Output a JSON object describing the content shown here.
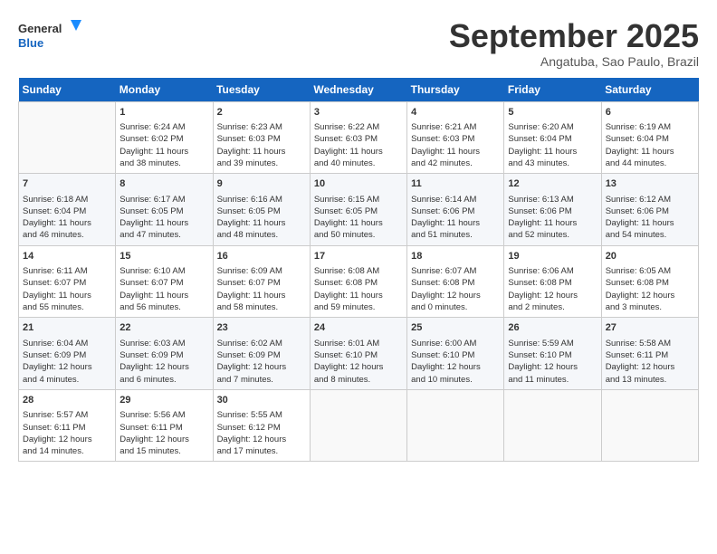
{
  "header": {
    "logo_line1": "General",
    "logo_line2": "Blue",
    "month": "September 2025",
    "location": "Angatuba, Sao Paulo, Brazil"
  },
  "days_of_week": [
    "Sunday",
    "Monday",
    "Tuesday",
    "Wednesday",
    "Thursday",
    "Friday",
    "Saturday"
  ],
  "weeks": [
    [
      {
        "day": "",
        "info": ""
      },
      {
        "day": "1",
        "info": "Sunrise: 6:24 AM\nSunset: 6:02 PM\nDaylight: 11 hours\nand 38 minutes."
      },
      {
        "day": "2",
        "info": "Sunrise: 6:23 AM\nSunset: 6:03 PM\nDaylight: 11 hours\nand 39 minutes."
      },
      {
        "day": "3",
        "info": "Sunrise: 6:22 AM\nSunset: 6:03 PM\nDaylight: 11 hours\nand 40 minutes."
      },
      {
        "day": "4",
        "info": "Sunrise: 6:21 AM\nSunset: 6:03 PM\nDaylight: 11 hours\nand 42 minutes."
      },
      {
        "day": "5",
        "info": "Sunrise: 6:20 AM\nSunset: 6:04 PM\nDaylight: 11 hours\nand 43 minutes."
      },
      {
        "day": "6",
        "info": "Sunrise: 6:19 AM\nSunset: 6:04 PM\nDaylight: 11 hours\nand 44 minutes."
      }
    ],
    [
      {
        "day": "7",
        "info": "Sunrise: 6:18 AM\nSunset: 6:04 PM\nDaylight: 11 hours\nand 46 minutes."
      },
      {
        "day": "8",
        "info": "Sunrise: 6:17 AM\nSunset: 6:05 PM\nDaylight: 11 hours\nand 47 minutes."
      },
      {
        "day": "9",
        "info": "Sunrise: 6:16 AM\nSunset: 6:05 PM\nDaylight: 11 hours\nand 48 minutes."
      },
      {
        "day": "10",
        "info": "Sunrise: 6:15 AM\nSunset: 6:05 PM\nDaylight: 11 hours\nand 50 minutes."
      },
      {
        "day": "11",
        "info": "Sunrise: 6:14 AM\nSunset: 6:06 PM\nDaylight: 11 hours\nand 51 minutes."
      },
      {
        "day": "12",
        "info": "Sunrise: 6:13 AM\nSunset: 6:06 PM\nDaylight: 11 hours\nand 52 minutes."
      },
      {
        "day": "13",
        "info": "Sunrise: 6:12 AM\nSunset: 6:06 PM\nDaylight: 11 hours\nand 54 minutes."
      }
    ],
    [
      {
        "day": "14",
        "info": "Sunrise: 6:11 AM\nSunset: 6:07 PM\nDaylight: 11 hours\nand 55 minutes."
      },
      {
        "day": "15",
        "info": "Sunrise: 6:10 AM\nSunset: 6:07 PM\nDaylight: 11 hours\nand 56 minutes."
      },
      {
        "day": "16",
        "info": "Sunrise: 6:09 AM\nSunset: 6:07 PM\nDaylight: 11 hours\nand 58 minutes."
      },
      {
        "day": "17",
        "info": "Sunrise: 6:08 AM\nSunset: 6:08 PM\nDaylight: 11 hours\nand 59 minutes."
      },
      {
        "day": "18",
        "info": "Sunrise: 6:07 AM\nSunset: 6:08 PM\nDaylight: 12 hours\nand 0 minutes."
      },
      {
        "day": "19",
        "info": "Sunrise: 6:06 AM\nSunset: 6:08 PM\nDaylight: 12 hours\nand 2 minutes."
      },
      {
        "day": "20",
        "info": "Sunrise: 6:05 AM\nSunset: 6:08 PM\nDaylight: 12 hours\nand 3 minutes."
      }
    ],
    [
      {
        "day": "21",
        "info": "Sunrise: 6:04 AM\nSunset: 6:09 PM\nDaylight: 12 hours\nand 4 minutes."
      },
      {
        "day": "22",
        "info": "Sunrise: 6:03 AM\nSunset: 6:09 PM\nDaylight: 12 hours\nand 6 minutes."
      },
      {
        "day": "23",
        "info": "Sunrise: 6:02 AM\nSunset: 6:09 PM\nDaylight: 12 hours\nand 7 minutes."
      },
      {
        "day": "24",
        "info": "Sunrise: 6:01 AM\nSunset: 6:10 PM\nDaylight: 12 hours\nand 8 minutes."
      },
      {
        "day": "25",
        "info": "Sunrise: 6:00 AM\nSunset: 6:10 PM\nDaylight: 12 hours\nand 10 minutes."
      },
      {
        "day": "26",
        "info": "Sunrise: 5:59 AM\nSunset: 6:10 PM\nDaylight: 12 hours\nand 11 minutes."
      },
      {
        "day": "27",
        "info": "Sunrise: 5:58 AM\nSunset: 6:11 PM\nDaylight: 12 hours\nand 13 minutes."
      }
    ],
    [
      {
        "day": "28",
        "info": "Sunrise: 5:57 AM\nSunset: 6:11 PM\nDaylight: 12 hours\nand 14 minutes."
      },
      {
        "day": "29",
        "info": "Sunrise: 5:56 AM\nSunset: 6:11 PM\nDaylight: 12 hours\nand 15 minutes."
      },
      {
        "day": "30",
        "info": "Sunrise: 5:55 AM\nSunset: 6:12 PM\nDaylight: 12 hours\nand 17 minutes."
      },
      {
        "day": "",
        "info": ""
      },
      {
        "day": "",
        "info": ""
      },
      {
        "day": "",
        "info": ""
      },
      {
        "day": "",
        "info": ""
      }
    ]
  ]
}
